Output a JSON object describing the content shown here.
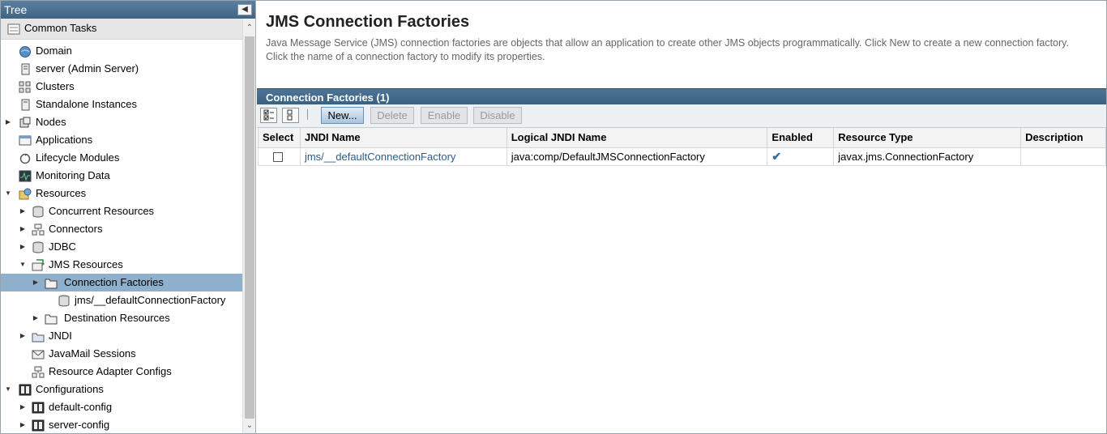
{
  "tree": {
    "header": "Tree",
    "collapse_icon": "collapse-left-icon",
    "items": [
      {
        "label": "Common Tasks",
        "icon": "tasks-icon"
      },
      {
        "label": "Domain",
        "icon": "domain-icon"
      },
      {
        "label": "server (Admin Server)",
        "icon": "server-icon"
      },
      {
        "label": "Clusters",
        "icon": "clusters-icon"
      },
      {
        "label": "Standalone Instances",
        "icon": "instances-icon"
      },
      {
        "label": "Nodes",
        "icon": "nodes-icon"
      },
      {
        "label": "Applications",
        "icon": "applications-icon"
      },
      {
        "label": "Lifecycle Modules",
        "icon": "lifecycle-icon"
      },
      {
        "label": "Monitoring Data",
        "icon": "monitoring-icon"
      },
      {
        "label": "Resources",
        "icon": "resources-icon"
      },
      {
        "label": "Concurrent Resources",
        "icon": "database-icon"
      },
      {
        "label": "Connectors",
        "icon": "connectors-icon"
      },
      {
        "label": "JDBC",
        "icon": "database-icon"
      },
      {
        "label": "JMS Resources",
        "icon": "jms-icon"
      },
      {
        "label": "Connection Factories",
        "icon": "folder-icon"
      },
      {
        "label": "jms/__defaultConnectionFactory",
        "icon": "database-icon"
      },
      {
        "label": "Destination Resources",
        "icon": "folder-icon"
      },
      {
        "label": "JNDI",
        "icon": "jndi-icon"
      },
      {
        "label": "JavaMail Sessions",
        "icon": "mail-icon"
      },
      {
        "label": "Resource Adapter Configs",
        "icon": "connectors-icon"
      },
      {
        "label": "Configurations",
        "icon": "config-icon"
      },
      {
        "label": "default-config",
        "icon": "config-icon"
      },
      {
        "label": "server-config",
        "icon": "config-icon"
      }
    ]
  },
  "main": {
    "title": "JMS Connection Factories",
    "description": "Java Message Service (JMS) connection factories are objects that allow an application to create other JMS objects programmatically. Click New to create a new connection factory. Click the name of a connection factory to modify its properties.",
    "table_title": "Connection Factories (1)",
    "toolbar": {
      "select_all_icon": "select-all-icon",
      "deselect_all_icon": "deselect-all-icon",
      "new_label": "New...",
      "delete_label": "Delete",
      "enable_label": "Enable",
      "disable_label": "Disable"
    },
    "columns": [
      "Select",
      "JNDI Name",
      "Logical JNDI Name",
      "Enabled",
      "Resource Type",
      "Description"
    ],
    "rows": [
      {
        "jndi_name": "jms/__defaultConnectionFactory",
        "logical_jndi_name": "java:comp/DefaultJMSConnectionFactory",
        "enabled": "✔",
        "resource_type": "javax.jms.ConnectionFactory",
        "description": ""
      }
    ]
  }
}
